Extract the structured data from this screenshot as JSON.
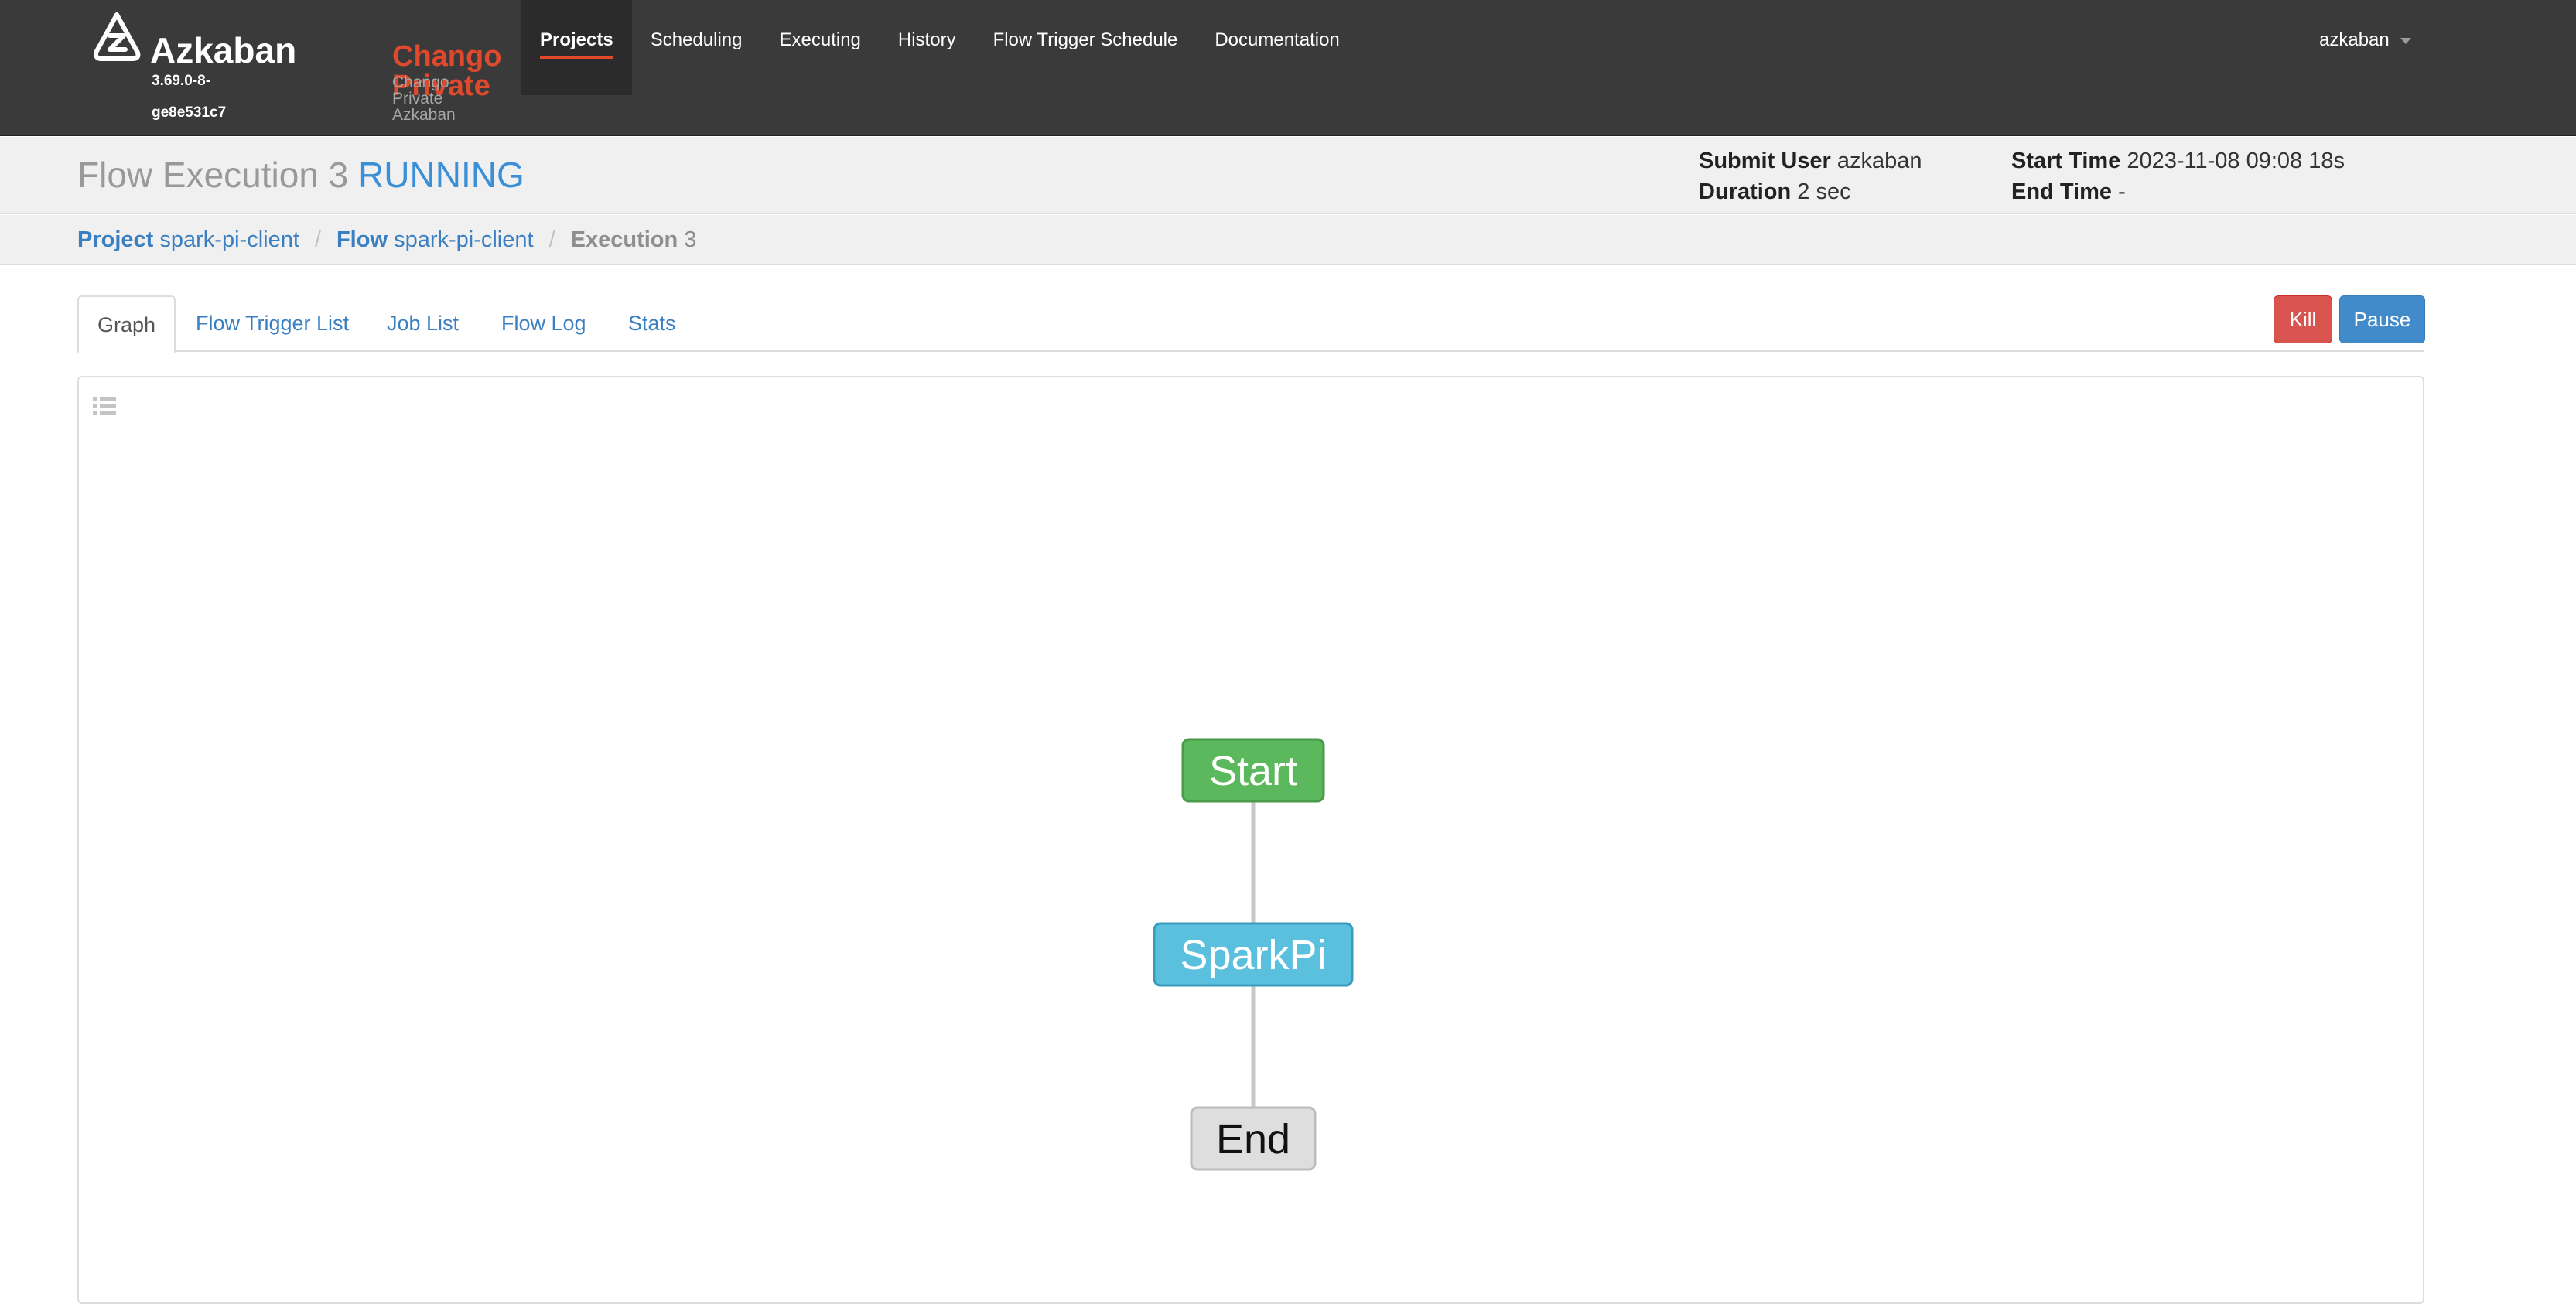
{
  "brand": {
    "name": "Azkaban",
    "version": "3.69.0-8-ge8e531c7",
    "env_title": "Chango Private",
    "env_subtitle": "Chango Private Azkaban"
  },
  "nav": {
    "items": [
      {
        "label": "Projects",
        "active": true
      },
      {
        "label": "Scheduling",
        "active": false
      },
      {
        "label": "Executing",
        "active": false
      },
      {
        "label": "History",
        "active": false
      },
      {
        "label": "Flow Trigger Schedule",
        "active": false
      },
      {
        "label": "Documentation",
        "active": false
      }
    ],
    "user": "azkaban"
  },
  "header": {
    "title_prefix": "Flow Execution",
    "exec_id": "3",
    "status": "RUNNING",
    "submit_user_label": "Submit User",
    "submit_user": "azkaban",
    "duration_label": "Duration",
    "duration": "2 sec",
    "start_time_label": "Start Time",
    "start_time": "2023-11-08 09:08 18s",
    "end_time_label": "End Time",
    "end_time": "-"
  },
  "breadcrumb": {
    "project_label": "Project",
    "project": "spark-pi-client",
    "flow_label": "Flow",
    "flow": "spark-pi-client",
    "execution_label": "Execution",
    "execution": "3",
    "separator": "/"
  },
  "tabs": [
    {
      "label": "Graph",
      "active": true
    },
    {
      "label": "Flow Trigger List",
      "active": false
    },
    {
      "label": "Job List",
      "active": false
    },
    {
      "label": "Flow Log",
      "active": false
    },
    {
      "label": "Stats",
      "active": false
    }
  ],
  "actions": {
    "kill_label": "Kill",
    "pause_label": "Pause"
  },
  "graph": {
    "nodes": [
      {
        "id": "start",
        "label": "Start",
        "status": "succeeded",
        "fill": "#5cb85c",
        "stroke": "#4a9a4a",
        "text": "#ffffff"
      },
      {
        "id": "sparkpi",
        "label": "SparkPi",
        "status": "running",
        "fill": "#5bc0de",
        "stroke": "#3a9bbd",
        "text": "#ffffff"
      },
      {
        "id": "end",
        "label": "End",
        "status": "ready",
        "fill": "#dedede",
        "stroke": "#bcbcbc",
        "text": "#111111"
      }
    ],
    "edges": [
      {
        "from": "start",
        "to": "sparkpi"
      },
      {
        "from": "sparkpi",
        "to": "end"
      }
    ]
  },
  "colors": {
    "navbar": "#3a3a3a",
    "accent": "#e0492c",
    "link": "#3a7fc1",
    "running": "#3a8fd6",
    "kill": "#d9534f",
    "pause": "#428bca"
  }
}
